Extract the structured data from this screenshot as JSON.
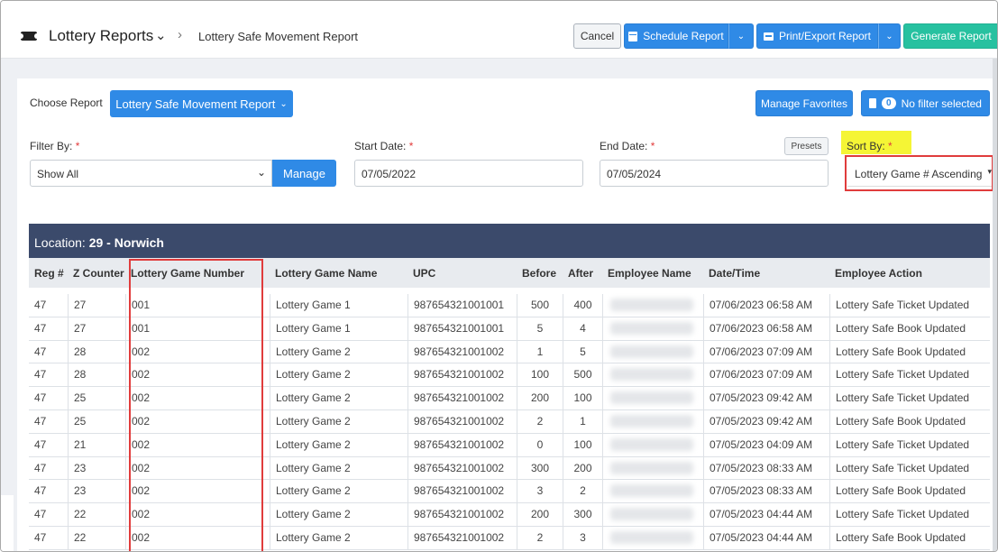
{
  "header": {
    "app_title": "Lottery Reports",
    "breadcrumb_current": "Lottery Safe Movement Report",
    "cancel_label": "Cancel",
    "schedule_label": "Schedule Report",
    "print_label": "Print/Export Report",
    "generate_label": "Generate Report"
  },
  "controls": {
    "choose_report_label": "Choose Report",
    "report_selected": "Lottery Safe Movement Report",
    "manage_favorites_label": "Manage Favorites",
    "filter_count": "0",
    "filter_status": "No filter selected",
    "filter_by_label": "Filter By:",
    "filter_by_value": "Show All",
    "manage_label": "Manage",
    "start_date_label": "Start Date:",
    "start_date_value": "07/05/2022",
    "end_date_label": "End Date:",
    "end_date_value": "07/05/2024",
    "presets_label": "Presets",
    "sort_by_label": "Sort By:",
    "sort_by_value": "Lottery Game # Ascending",
    "required_mark": "*"
  },
  "table": {
    "location_prefix": "Location:",
    "location_name": "29 - Norwich",
    "columns": [
      "Reg #",
      "Z Counter",
      "Lottery Game Number",
      "Lottery Game Name",
      "UPC",
      "Before",
      "After",
      "Employee Name",
      "Date/Time",
      "Employee Action"
    ],
    "rows": [
      [
        "47",
        "27",
        "001",
        "Lottery Game 1",
        "987654321001001",
        "500",
        "400",
        "",
        "07/06/2023 06:58 AM",
        "Lottery Safe Ticket Updated"
      ],
      [
        "47",
        "27",
        "001",
        "Lottery Game 1",
        "987654321001001",
        "5",
        "4",
        "",
        "07/06/2023 06:58 AM",
        "Lottery Safe Book Updated"
      ],
      [
        "47",
        "28",
        "002",
        "Lottery Game 2",
        "987654321001002",
        "1",
        "5",
        "",
        "07/06/2023 07:09 AM",
        "Lottery Safe Book Updated"
      ],
      [
        "47",
        "28",
        "002",
        "Lottery Game 2",
        "987654321001002",
        "100",
        "500",
        "",
        "07/06/2023 07:09 AM",
        "Lottery Safe Ticket Updated"
      ],
      [
        "47",
        "25",
        "002",
        "Lottery Game 2",
        "987654321001002",
        "200",
        "100",
        "",
        "07/05/2023 09:42 AM",
        "Lottery Safe Ticket Updated"
      ],
      [
        "47",
        "25",
        "002",
        "Lottery Game 2",
        "987654321001002",
        "2",
        "1",
        "",
        "07/05/2023 09:42 AM",
        "Lottery Safe Book Updated"
      ],
      [
        "47",
        "21",
        "002",
        "Lottery Game 2",
        "987654321001002",
        "0",
        "100",
        "",
        "07/05/2023 04:09 AM",
        "Lottery Safe Ticket Updated"
      ],
      [
        "47",
        "23",
        "002",
        "Lottery Game 2",
        "987654321001002",
        "300",
        "200",
        "",
        "07/05/2023 08:33 AM",
        "Lottery Safe Ticket Updated"
      ],
      [
        "47",
        "23",
        "002",
        "Lottery Game 2",
        "987654321001002",
        "3",
        "2",
        "",
        "07/05/2023 08:33 AM",
        "Lottery Safe Book Updated"
      ],
      [
        "47",
        "22",
        "002",
        "Lottery Game 2",
        "987654321001002",
        "200",
        "300",
        "",
        "07/05/2023 04:44 AM",
        "Lottery Safe Ticket Updated"
      ],
      [
        "47",
        "22",
        "002",
        "Lottery Game 2",
        "987654321001002",
        "2",
        "3",
        "",
        "07/05/2023 04:44 AM",
        "Lottery Safe Book Updated"
      ]
    ]
  },
  "colors": {
    "primary": "#2f8ae6",
    "generate": "#27c1a0",
    "location_bar": "#3b4a6b",
    "highlight": "#f5f535",
    "annotation_red": "#e03c3c"
  },
  "icons": [
    "ticket-icon",
    "chevron-down-icon",
    "chevron-right-icon",
    "calendar-icon",
    "printer-icon",
    "filter-icon"
  ]
}
